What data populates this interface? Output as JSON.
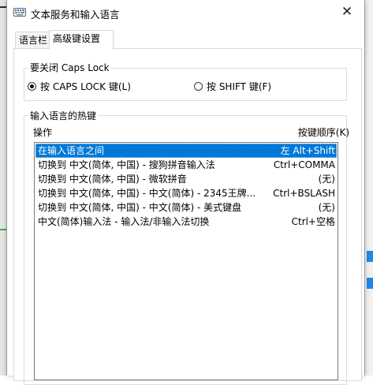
{
  "window": {
    "title": "文本服务和输入语言",
    "close_glyph": "✕"
  },
  "tabs": [
    {
      "label": "语言栏"
    },
    {
      "label": "高级键设置"
    }
  ],
  "caps_lock": {
    "group_label": "要关闭 Caps Lock",
    "options": [
      {
        "label": "按 CAPS LOCK 键(L)",
        "checked": true
      },
      {
        "label": "按 SHIFT 键(F)",
        "checked": false
      }
    ]
  },
  "hotkeys": {
    "group_label": "输入语言的热键",
    "col_action": "操作",
    "col_keys": "按键顺序(K)",
    "rows": [
      {
        "action": "在输入语言之间",
        "keys": "左 Alt+Shift",
        "selected": true
      },
      {
        "action": "切换到 中文(简体, 中国) - 搜狗拼音输入法",
        "keys": "Ctrl+COMMA",
        "selected": false
      },
      {
        "action": "切换到 中文(简体, 中国) - 微软拼音",
        "keys": "(无)",
        "selected": false
      },
      {
        "action": "切换到 中文(简体, 中国) - 中文(简体) - 2345王牌...",
        "keys": "Ctrl+BSLASH",
        "selected": false
      },
      {
        "action": "切换到 中文(简体, 中国) - 中文(简体) - 美式键盘",
        "keys": "(无)",
        "selected": false
      },
      {
        "action": "中文(简体)输入法 - 输入法/非输入法切换",
        "keys": "Ctrl+空格",
        "selected": false
      }
    ]
  },
  "colors": {
    "selection": "#0078d7",
    "background_accent": "#1e88e5",
    "background_green": "#39b54a"
  }
}
